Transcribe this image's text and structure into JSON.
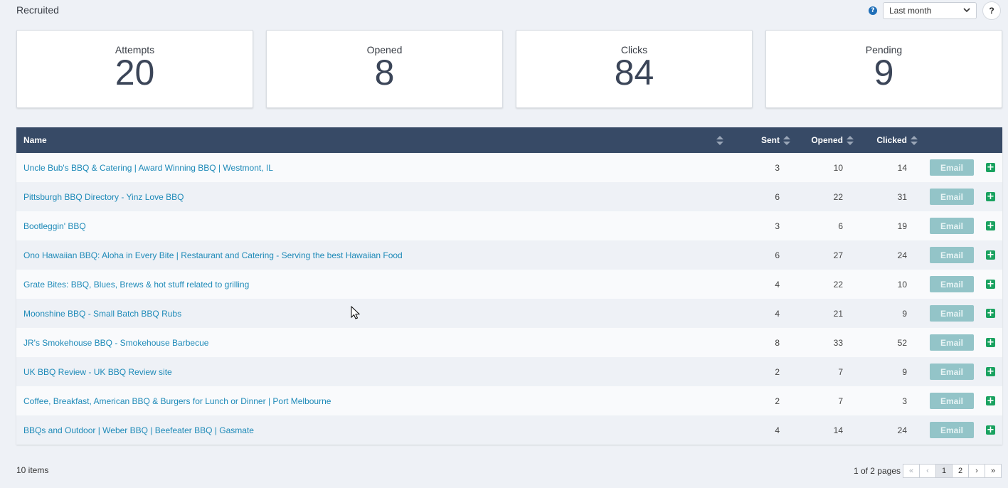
{
  "header": {
    "title": "Recruited",
    "period_select": "Last month",
    "help_label": "?"
  },
  "cards": [
    {
      "label": "Attempts",
      "value": "20"
    },
    {
      "label": "Opened",
      "value": "8"
    },
    {
      "label": "Clicks",
      "value": "84"
    },
    {
      "label": "Pending",
      "value": "9"
    }
  ],
  "table": {
    "columns": {
      "name": "Name",
      "sent": "Sent",
      "opened": "Opened",
      "clicked": "Clicked"
    },
    "email_label": "Email",
    "rows": [
      {
        "name": "Uncle Bub's BBQ & Catering | Award Winning BBQ | Westmont, IL",
        "sent": "3",
        "opened": "10",
        "clicked": "14"
      },
      {
        "name": "Pittsburgh BBQ Directory - Yinz Love BBQ",
        "sent": "6",
        "opened": "22",
        "clicked": "31"
      },
      {
        "name": "Bootleggin' BBQ",
        "sent": "3",
        "opened": "6",
        "clicked": "19"
      },
      {
        "name": "Ono Hawaiian BBQ: Aloha in Every Bite | Restaurant and Catering - Serving the best Hawaiian Food",
        "sent": "6",
        "opened": "27",
        "clicked": "24"
      },
      {
        "name": "Grate Bites: BBQ, Blues, Brews & hot stuff related to grilling",
        "sent": "4",
        "opened": "22",
        "clicked": "10"
      },
      {
        "name": "Moonshine BBQ - Small Batch BBQ Rubs",
        "sent": "4",
        "opened": "21",
        "clicked": "9"
      },
      {
        "name": "JR's Smokehouse BBQ - Smokehouse Barbecue",
        "sent": "8",
        "opened": "33",
        "clicked": "52"
      },
      {
        "name": "UK BBQ Review - UK BBQ Review site",
        "sent": "2",
        "opened": "7",
        "clicked": "9"
      },
      {
        "name": "Coffee, Breakfast, American BBQ & Burgers for Lunch or Dinner | Port Melbourne",
        "sent": "2",
        "opened": "7",
        "clicked": "3"
      },
      {
        "name": "BBQs and Outdoor | Weber BBQ | Beefeater BBQ | Gasmate",
        "sent": "4",
        "opened": "14",
        "clicked": "24"
      }
    ]
  },
  "footer": {
    "items_count": "10 items",
    "pages_text": "1 of 2 pages",
    "pager": {
      "first": "«",
      "prev": "‹",
      "page1": "1",
      "page2": "2",
      "next": "›",
      "last": "»"
    }
  },
  "icons": {
    "help": "question-circle-icon",
    "chevron": "chevron-down-icon",
    "add": "plus-square-icon",
    "sort": "sort-icon"
  },
  "colors": {
    "header_bg": "#374a66",
    "link": "#1e8ab8",
    "email_btn": "#93c4c8",
    "plus": "#1aa260"
  }
}
